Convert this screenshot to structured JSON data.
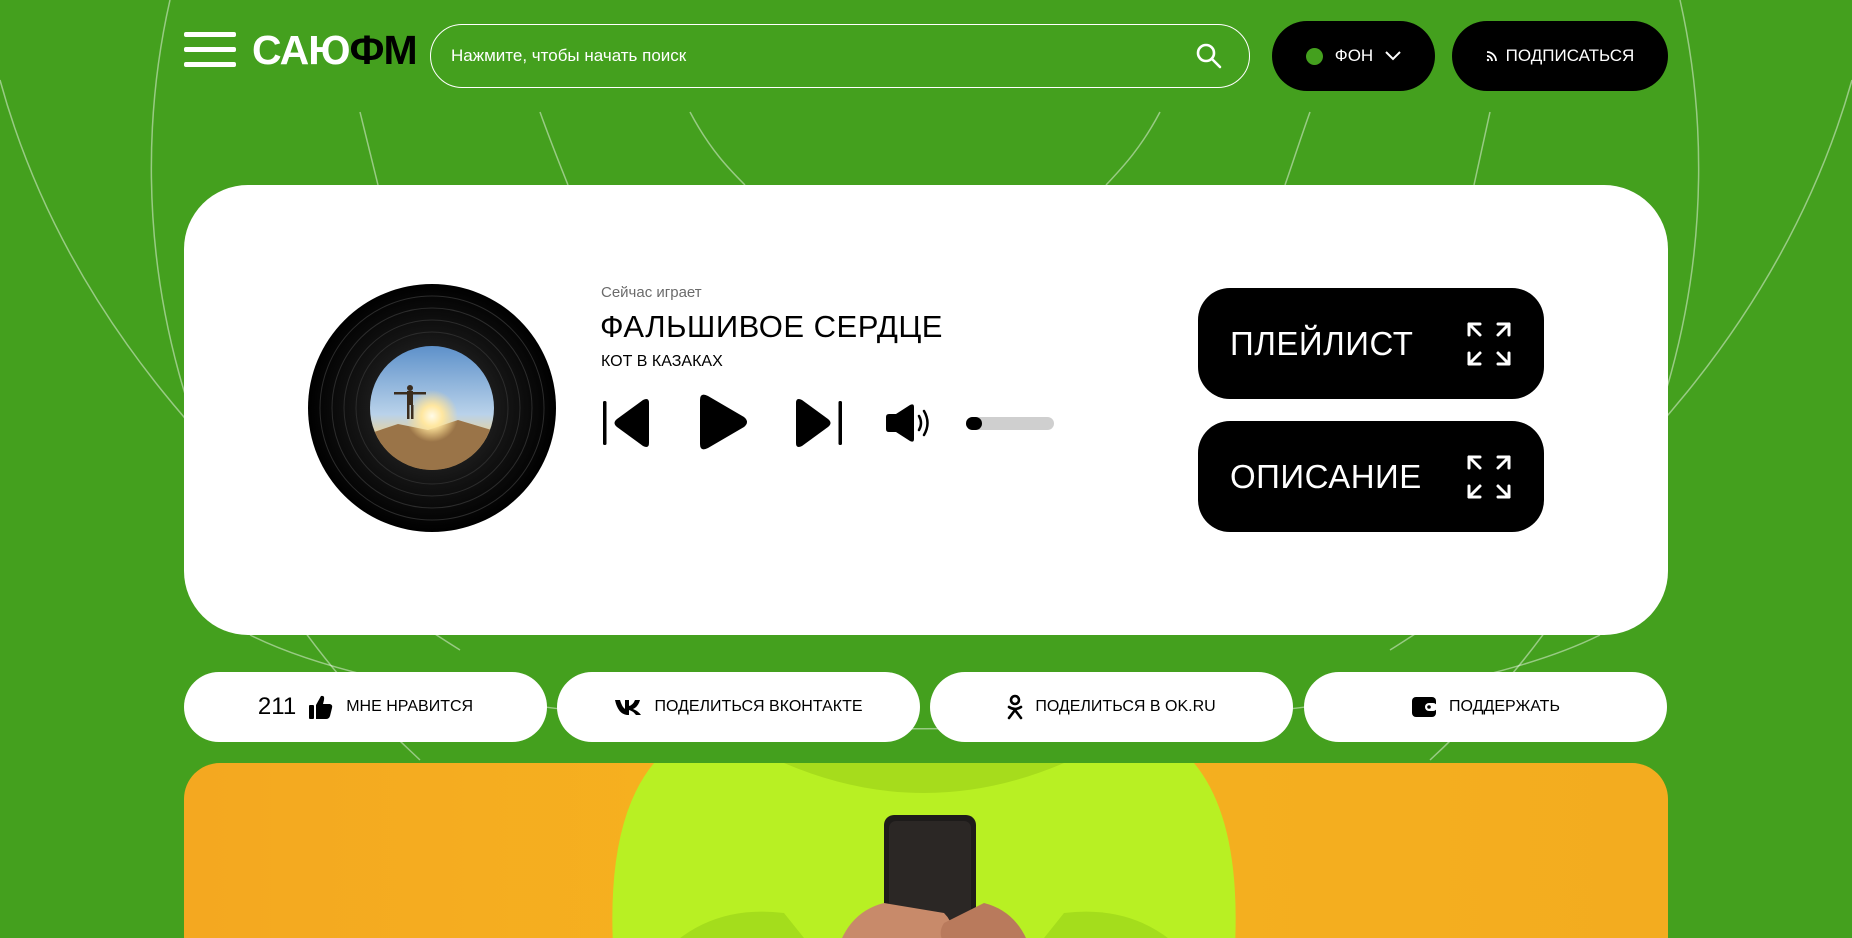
{
  "header": {
    "logo_part1": "САЮ",
    "logo_part2": "ФМ",
    "search_placeholder": "Нажмите, чтобы начать поиск",
    "background_label": "ФОН",
    "subscribe_label": "ПОДПИСАТЬСЯ"
  },
  "player": {
    "now_playing_label": "Сейчас играет",
    "track_title": "ФАЛЬШИВОЕ СЕРДЦЕ",
    "artist": "КОТ В КАЗАКАХ",
    "volume": 0.18,
    "playlist_label": "ПЛЕЙЛИСТ",
    "description_label": "ОПИСАНИЕ"
  },
  "actions": {
    "likes_count": "211",
    "like_label": "МНЕ НРАВИТСЯ",
    "vk_label": "ПОДЕЛИТЬСЯ ВКОНТАКТЕ",
    "ok_label": "ПОДЕЛИТЬСЯ В OK.RU",
    "support_label": "ПОДДЕРЖАТЬ"
  },
  "colors": {
    "background": "#44a01e",
    "accent_dark": "#000000",
    "card": "#ffffff",
    "banner": "#f4a820"
  },
  "icons": [
    "menu-icon",
    "search-icon",
    "chevron-down-icon",
    "rss-icon",
    "prev-icon",
    "play-icon",
    "next-icon",
    "volume-icon",
    "expand-icon",
    "thumbs-up-icon",
    "vk-icon",
    "ok-icon",
    "wallet-icon"
  ]
}
